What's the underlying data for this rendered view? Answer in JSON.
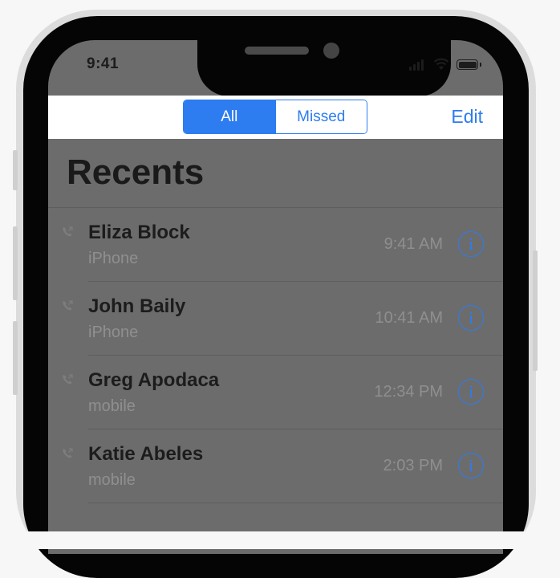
{
  "status_bar": {
    "time": "9:41"
  },
  "nav": {
    "segments": [
      "All",
      "Missed"
    ],
    "edit_label": "Edit"
  },
  "title": "Recents",
  "recents": [
    {
      "name": "Eliza Block",
      "type": "iPhone",
      "time": "9:41 AM"
    },
    {
      "name": "John Baily",
      "type": "iPhone",
      "time": "10:41 AM"
    },
    {
      "name": "Greg Apodaca",
      "type": "mobile",
      "time": "12:34 PM"
    },
    {
      "name": "Katie Abeles",
      "type": "mobile",
      "time": "2:03 PM"
    }
  ],
  "icons": {
    "info": "i"
  },
  "colors": {
    "accent": "#2d7cf0",
    "screen_overlay": "#6c6c6c"
  }
}
